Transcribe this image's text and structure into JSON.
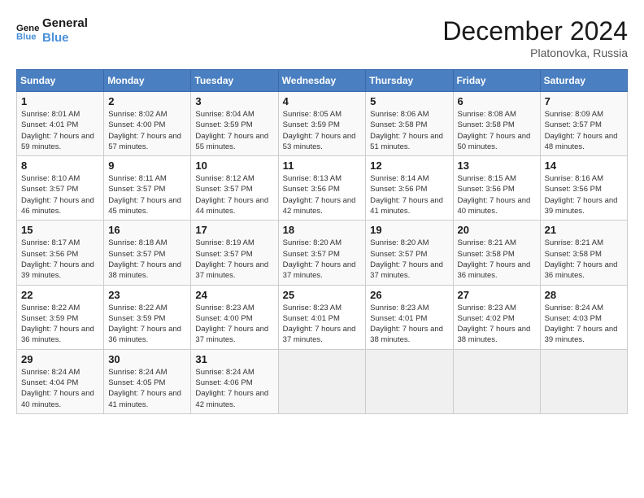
{
  "header": {
    "logo_line1": "General",
    "logo_line2": "Blue",
    "month_title": "December 2024",
    "location": "Platonovka, Russia"
  },
  "weekdays": [
    "Sunday",
    "Monday",
    "Tuesday",
    "Wednesday",
    "Thursday",
    "Friday",
    "Saturday"
  ],
  "weeks": [
    [
      {
        "day": "1",
        "sunrise": "8:01 AM",
        "sunset": "4:01 PM",
        "daylight": "7 hours and 59 minutes."
      },
      {
        "day": "2",
        "sunrise": "8:02 AM",
        "sunset": "4:00 PM",
        "daylight": "7 hours and 57 minutes."
      },
      {
        "day": "3",
        "sunrise": "8:04 AM",
        "sunset": "3:59 PM",
        "daylight": "7 hours and 55 minutes."
      },
      {
        "day": "4",
        "sunrise": "8:05 AM",
        "sunset": "3:59 PM",
        "daylight": "7 hours and 53 minutes."
      },
      {
        "day": "5",
        "sunrise": "8:06 AM",
        "sunset": "3:58 PM",
        "daylight": "7 hours and 51 minutes."
      },
      {
        "day": "6",
        "sunrise": "8:08 AM",
        "sunset": "3:58 PM",
        "daylight": "7 hours and 50 minutes."
      },
      {
        "day": "7",
        "sunrise": "8:09 AM",
        "sunset": "3:57 PM",
        "daylight": "7 hours and 48 minutes."
      }
    ],
    [
      {
        "day": "8",
        "sunrise": "8:10 AM",
        "sunset": "3:57 PM",
        "daylight": "7 hours and 46 minutes."
      },
      {
        "day": "9",
        "sunrise": "8:11 AM",
        "sunset": "3:57 PM",
        "daylight": "7 hours and 45 minutes."
      },
      {
        "day": "10",
        "sunrise": "8:12 AM",
        "sunset": "3:57 PM",
        "daylight": "7 hours and 44 minutes."
      },
      {
        "day": "11",
        "sunrise": "8:13 AM",
        "sunset": "3:56 PM",
        "daylight": "7 hours and 42 minutes."
      },
      {
        "day": "12",
        "sunrise": "8:14 AM",
        "sunset": "3:56 PM",
        "daylight": "7 hours and 41 minutes."
      },
      {
        "day": "13",
        "sunrise": "8:15 AM",
        "sunset": "3:56 PM",
        "daylight": "7 hours and 40 minutes."
      },
      {
        "day": "14",
        "sunrise": "8:16 AM",
        "sunset": "3:56 PM",
        "daylight": "7 hours and 39 minutes."
      }
    ],
    [
      {
        "day": "15",
        "sunrise": "8:17 AM",
        "sunset": "3:56 PM",
        "daylight": "7 hours and 39 minutes."
      },
      {
        "day": "16",
        "sunrise": "8:18 AM",
        "sunset": "3:57 PM",
        "daylight": "7 hours and 38 minutes."
      },
      {
        "day": "17",
        "sunrise": "8:19 AM",
        "sunset": "3:57 PM",
        "daylight": "7 hours and 37 minutes."
      },
      {
        "day": "18",
        "sunrise": "8:20 AM",
        "sunset": "3:57 PM",
        "daylight": "7 hours and 37 minutes."
      },
      {
        "day": "19",
        "sunrise": "8:20 AM",
        "sunset": "3:57 PM",
        "daylight": "7 hours and 37 minutes."
      },
      {
        "day": "20",
        "sunrise": "8:21 AM",
        "sunset": "3:58 PM",
        "daylight": "7 hours and 36 minutes."
      },
      {
        "day": "21",
        "sunrise": "8:21 AM",
        "sunset": "3:58 PM",
        "daylight": "7 hours and 36 minutes."
      }
    ],
    [
      {
        "day": "22",
        "sunrise": "8:22 AM",
        "sunset": "3:59 PM",
        "daylight": "7 hours and 36 minutes."
      },
      {
        "day": "23",
        "sunrise": "8:22 AM",
        "sunset": "3:59 PM",
        "daylight": "7 hours and 36 minutes."
      },
      {
        "day": "24",
        "sunrise": "8:23 AM",
        "sunset": "4:00 PM",
        "daylight": "7 hours and 37 minutes."
      },
      {
        "day": "25",
        "sunrise": "8:23 AM",
        "sunset": "4:01 PM",
        "daylight": "7 hours and 37 minutes."
      },
      {
        "day": "26",
        "sunrise": "8:23 AM",
        "sunset": "4:01 PM",
        "daylight": "7 hours and 38 minutes."
      },
      {
        "day": "27",
        "sunrise": "8:23 AM",
        "sunset": "4:02 PM",
        "daylight": "7 hours and 38 minutes."
      },
      {
        "day": "28",
        "sunrise": "8:24 AM",
        "sunset": "4:03 PM",
        "daylight": "7 hours and 39 minutes."
      }
    ],
    [
      {
        "day": "29",
        "sunrise": "8:24 AM",
        "sunset": "4:04 PM",
        "daylight": "7 hours and 40 minutes."
      },
      {
        "day": "30",
        "sunrise": "8:24 AM",
        "sunset": "4:05 PM",
        "daylight": "7 hours and 41 minutes."
      },
      {
        "day": "31",
        "sunrise": "8:24 AM",
        "sunset": "4:06 PM",
        "daylight": "7 hours and 42 minutes."
      },
      null,
      null,
      null,
      null
    ]
  ],
  "labels": {
    "sunrise": "Sunrise:",
    "sunset": "Sunset:",
    "daylight": "Daylight:"
  }
}
